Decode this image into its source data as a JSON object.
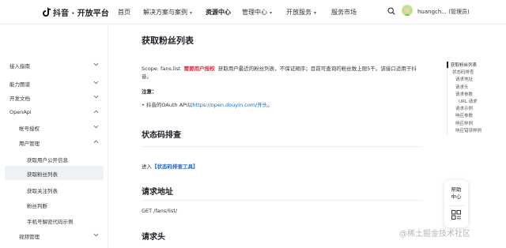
{
  "header": {
    "logo_text": "抖音 · 开放平台",
    "nav": [
      {
        "label": "首页",
        "has_caret": false,
        "active": false
      },
      {
        "label": "解决方案与案例",
        "has_caret": true,
        "active": false
      },
      {
        "label": "资源中心",
        "has_caret": false,
        "active": true
      },
      {
        "label": "管理中心",
        "has_caret": true,
        "active": false
      },
      {
        "label": "开放服务",
        "has_caret": true,
        "active": false
      },
      {
        "label": "服务市场",
        "has_caret": false,
        "active": false
      }
    ],
    "user_label": "huangch... (管理员)"
  },
  "sidebar": {
    "items": [
      {
        "label": "接入指南",
        "level": 0,
        "chevron": "down",
        "active": false
      },
      {
        "label": "能力图谱",
        "level": 0,
        "chevron": "down",
        "active": false
      },
      {
        "label": "开发文档",
        "level": 0,
        "chevron": "down",
        "active": false
      },
      {
        "label": "OpenApi",
        "level": 0,
        "chevron": "up",
        "active": false
      },
      {
        "label": "帐号授权",
        "level": 1,
        "chevron": "down",
        "active": false
      },
      {
        "label": "用户管理",
        "level": 1,
        "chevron": "up",
        "active": false
      },
      {
        "label": "获取用户公开信息",
        "level": 2,
        "chevron": "",
        "active": false
      },
      {
        "label": "获取粉丝列表",
        "level": 2,
        "chevron": "",
        "active": true
      },
      {
        "label": "获取关注列表",
        "level": 2,
        "chevron": "",
        "active": false
      },
      {
        "label": "粉丝判断",
        "level": 2,
        "chevron": "",
        "active": false
      },
      {
        "label": "手机号解密代码示例",
        "level": 2,
        "chevron": "",
        "active": false
      },
      {
        "label": "视频管理",
        "level": 1,
        "chevron": "down",
        "active": false
      }
    ]
  },
  "main": {
    "title": "获取粉丝列表",
    "scope_prefix": "Scope: fans.list",
    "scope_badge": "需要用户授权",
    "scope_desc": "获取用户最近的粉丝列表，不保证顺序；目前可查询的粉丝数上限5千。该接口适用于抖",
    "scope_desc_cont": "音。",
    "note_title": "注意：",
    "bullet_prefix": "• 抖音的OAuth API以",
    "bullet_link": "https://open.douyin.com/开头",
    "bullet_suffix": "。",
    "section_status": "状态码排查",
    "status_prefix": "进入",
    "status_link": "【状态码排查工具】",
    "section_address": "请求地址",
    "address_value": "GET /fans/list/",
    "section_header": "请求头"
  },
  "toc": {
    "items": [
      {
        "label": "获取粉丝列表",
        "indent": 0,
        "active": true
      },
      {
        "label": "状态码排查",
        "indent": 1,
        "active": false
      },
      {
        "label": "请求地址",
        "indent": 2,
        "active": false
      },
      {
        "label": "请求头",
        "indent": 2,
        "active": false
      },
      {
        "label": "请求参数",
        "indent": 2,
        "active": false
      },
      {
        "label": "URL 请求",
        "indent": 3,
        "active": false
      },
      {
        "label": "请求示例",
        "indent": 2,
        "active": false
      },
      {
        "label": "响应参数",
        "indent": 2,
        "active": false
      },
      {
        "label": "响应样例",
        "indent": 2,
        "active": false
      },
      {
        "label": "响应错误样例",
        "indent": 2,
        "active": false
      }
    ]
  },
  "help": {
    "line1": "帮助",
    "line2": "中心"
  },
  "watermark": "@稀土掘金技术社区",
  "colors": {
    "accent_link": "#1967d2",
    "badge_red": "#e0263a",
    "active_bg": "#eef1f6"
  }
}
